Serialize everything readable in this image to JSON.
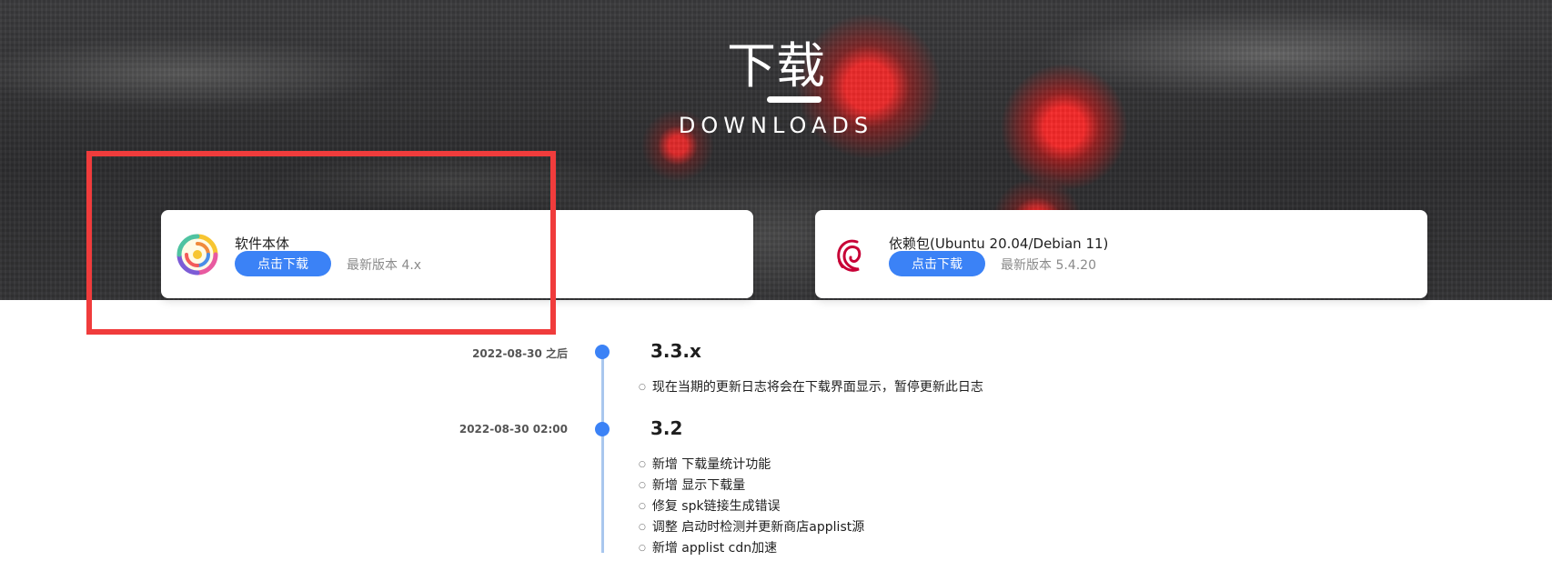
{
  "hero": {
    "title": "下载",
    "subtitle": "DOWNLOADS"
  },
  "cards": [
    {
      "name": "软件本体",
      "button": "点击下载",
      "version": "最新版本 4.x",
      "icon": "spark-store-logo-icon"
    },
    {
      "name": "依赖包(Ubuntu 20.04/Debian 11)",
      "button": "点击下载",
      "version": "最新版本 5.4.20",
      "icon": "debian-logo-icon"
    }
  ],
  "colors": {
    "accent": "#3b82f6",
    "highlight": "#f03c3c",
    "timeline": "#a9c7ee"
  },
  "timeline": [
    {
      "date": "2022-08-30 之后",
      "version": "3.3.x",
      "items": [
        "现在当期的更新日志将会在下载界面显示，暂停更新此日志"
      ]
    },
    {
      "date": "2022-08-30 02:00",
      "version": "3.2",
      "items": [
        "新增 下载量统计功能",
        "新增 显示下载量",
        "修复 spk链接生成错误",
        "调整 启动时检测并更新商店applist源",
        "新增 applist cdn加速"
      ]
    }
  ]
}
